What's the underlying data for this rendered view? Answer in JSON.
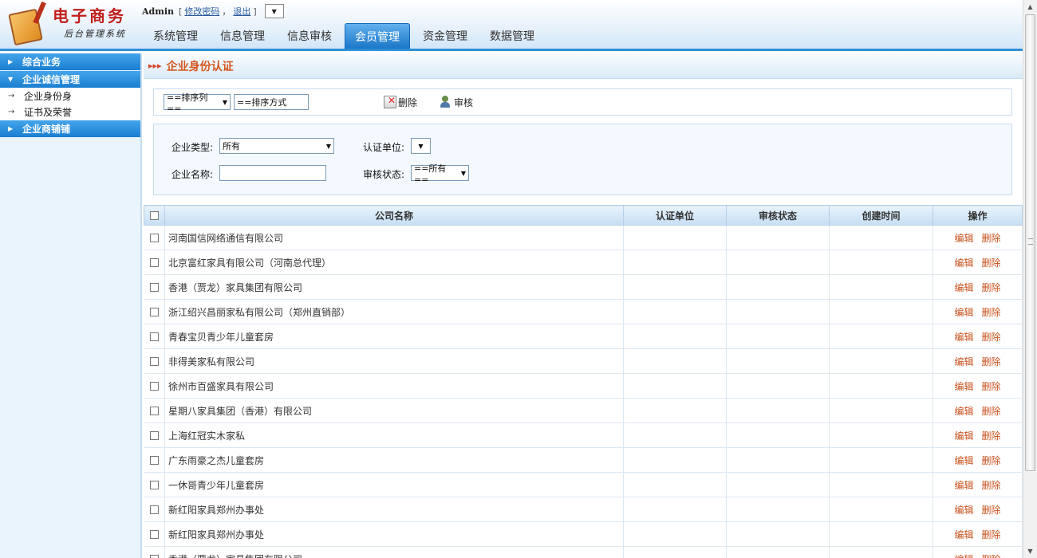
{
  "header": {
    "logo_title": "电子商务",
    "logo_subtitle": "后台管理系统",
    "user": "Admin",
    "bracket_open": "[",
    "change_password": "修改密码",
    "comma": "，",
    "logout": "退出",
    "bracket_close": "]"
  },
  "tabs": [
    {
      "label": "系统管理"
    },
    {
      "label": "信息管理"
    },
    {
      "label": "信息审核"
    },
    {
      "label": "会员管理"
    },
    {
      "label": "资金管理"
    },
    {
      "label": "数据管理"
    }
  ],
  "sidebar": {
    "group1": "综合业务",
    "group2": "企业诚信管理",
    "sub1": "企业身份身",
    "sub2": "证书及荣誉",
    "group3": "企业商铺铺"
  },
  "page_title": "企业身份认证",
  "toolbar": {
    "sort_column": "==排序列==",
    "sort_order": "==排序方式",
    "delete": "删除",
    "audit": "审核"
  },
  "filters": {
    "type_label": "企业类型:",
    "type_value": "所有",
    "cert_label": "认证单位:",
    "name_label": "企业名称:",
    "status_label": "审核状态:",
    "status_value": "==所有=="
  },
  "table": {
    "headers": [
      "公司名称",
      "认证单位",
      "审核状态",
      "创建时间",
      "操作"
    ],
    "edit_label": "编辑",
    "delete_label": "删除",
    "rows": [
      {
        "name": "河南国信网络通信有限公司"
      },
      {
        "name": "北京富红家具有限公司（河南总代理）"
      },
      {
        "name": "香港（贾龙）家具集团有限公司"
      },
      {
        "name": "浙江绍兴昌丽家私有限公司（郑州直销部）"
      },
      {
        "name": "青春宝贝青少年儿童套房"
      },
      {
        "name": "非得美家私有限公司"
      },
      {
        "name": "徐州市百盛家具有限公司"
      },
      {
        "name": "星期八家具集团（香港）有限公司"
      },
      {
        "name": "上海红冠实木家私"
      },
      {
        "name": "广东雨豪之杰儿童套房"
      },
      {
        "name": "一休哥青少年儿童套房"
      },
      {
        "name": "新红阳家具郑州办事处"
      },
      {
        "name": "新红阳家具郑州办事处"
      },
      {
        "name": "香港（贾龙）家具集团有限公司"
      }
    ]
  }
}
